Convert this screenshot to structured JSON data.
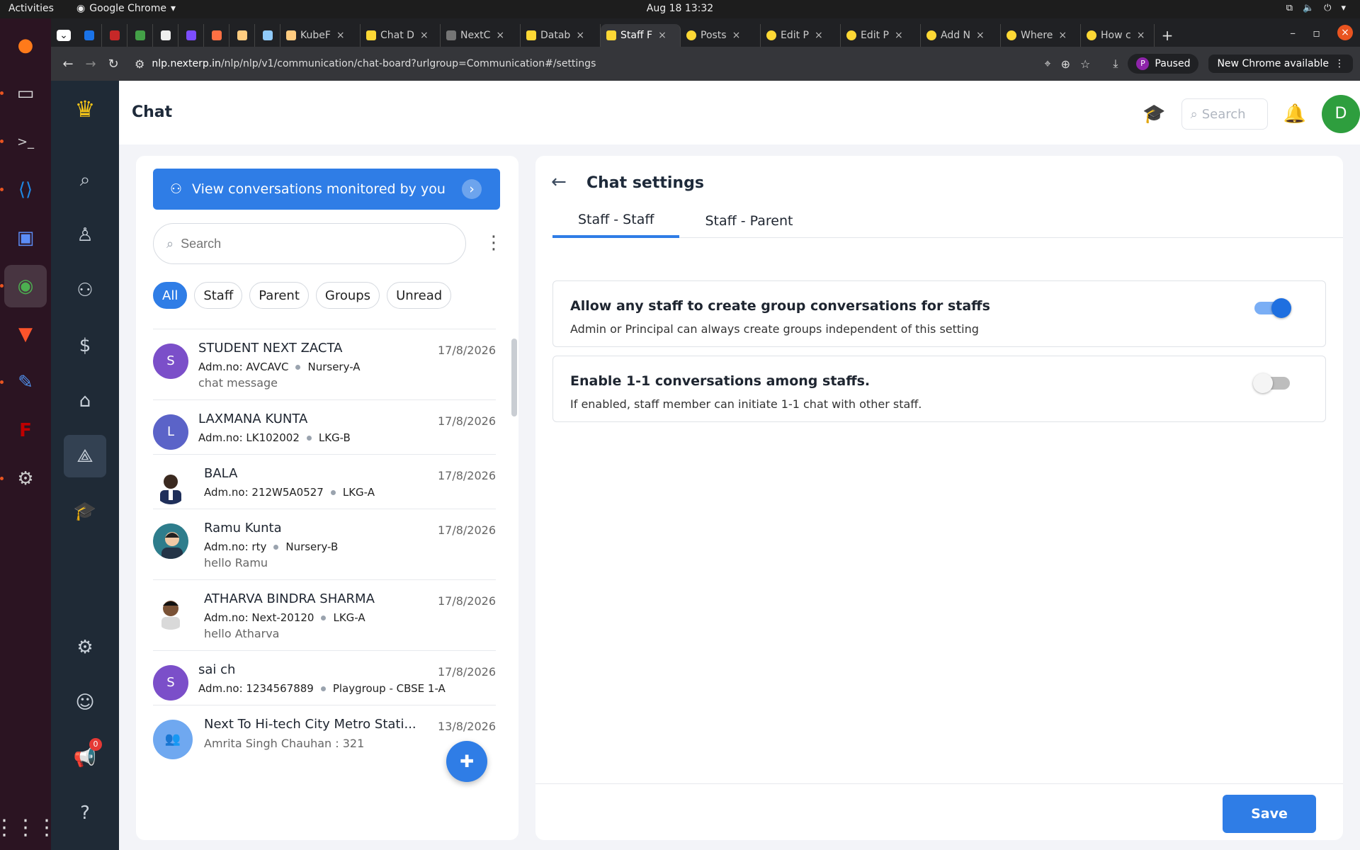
{
  "system": {
    "activities": "Activities",
    "app_name": "Google Chrome",
    "clock": "Aug 18  13:32"
  },
  "tabs": [
    {
      "label": ""
    },
    {
      "label": ""
    },
    {
      "label": ""
    },
    {
      "label": ""
    },
    {
      "label": ""
    },
    {
      "label": ""
    },
    {
      "label": ""
    },
    {
      "label": "KubeF"
    },
    {
      "label": "Chat D"
    },
    {
      "label": "NextC"
    },
    {
      "label": "Datab"
    },
    {
      "label": "Staff F"
    },
    {
      "label": "Posts"
    },
    {
      "label": "Edit P"
    },
    {
      "label": "Edit P"
    },
    {
      "label": "Add N"
    },
    {
      "label": "Where"
    },
    {
      "label": "How c"
    }
  ],
  "browser": {
    "url_host": "nlp.nexterp.in",
    "url_path": "/nlp/nlp/v1/communication/chat-board?urlgroup=Communication#/settings",
    "paused_label": "Paused",
    "profile_initial": "P",
    "update_label": "New Chrome available"
  },
  "app": {
    "title": "Chat",
    "search_placeholder": "Search",
    "user_initial": "D",
    "notification_count": "0"
  },
  "left": {
    "monitor_label": "View conversations monitored by you",
    "search_placeholder": "Search",
    "filters": [
      "All",
      "Staff",
      "Parent",
      "Groups",
      "Unread"
    ],
    "conversations": [
      {
        "initial": "S",
        "name": "STUDENT NEXT ZACTA",
        "adm": "Adm.no: AVCAVC",
        "class": "Nursery-A",
        "msg": "chat message",
        "date": "17/8/2026"
      },
      {
        "initial": "L",
        "name": "LAXMANA KUNTA",
        "adm": "Adm.no: LK102002",
        "class": "LKG-B",
        "msg": "",
        "date": "17/8/2026"
      },
      {
        "initial": "",
        "name": "BALA",
        "adm": "Adm.no: 212W5A0527",
        "class": "LKG-A",
        "msg": "",
        "date": "17/8/2026"
      },
      {
        "initial": "",
        "name": "Ramu Kunta",
        "adm": "Adm.no: rty",
        "class": "Nursery-B",
        "msg": "hello Ramu",
        "date": "17/8/2026"
      },
      {
        "initial": "",
        "name": "ATHARVA BINDRA SHARMA",
        "adm": "Adm.no: Next-20120",
        "class": "LKG-A",
        "msg": "hello Atharva",
        "date": "17/8/2026"
      },
      {
        "initial": "S",
        "name": "sai ch",
        "adm": "Adm.no: 1234567889",
        "class": "Playgroup - CBSE 1-A",
        "msg": "",
        "date": "17/8/2026"
      },
      {
        "initial": "",
        "name": "Next To Hi-tech City Metro Stati...",
        "adm": "",
        "class": "",
        "msg": "Amrita Singh Chauhan : 321",
        "date": "13/8/2026"
      }
    ]
  },
  "settings": {
    "title": "Chat settings",
    "tabs": [
      "Staff - Staff",
      "Staff - Parent"
    ],
    "items": [
      {
        "title": "Allow any staff to create group conversations for staffs",
        "desc": "Admin or Principal can always create groups independent of this setting",
        "enabled": true
      },
      {
        "title": "Enable 1-1 conversations among staffs.",
        "desc": "If enabled, staff member can initiate 1-1 chat with other staff.",
        "enabled": false
      }
    ],
    "save_label": "Save"
  },
  "colors": {
    "accent": "#2f7de6",
    "avatar_purple": "#7b4fc9",
    "avatar_indigo": "#5b63c8",
    "toggle_on": "#1e6fe0",
    "toggle_off": "#bdbdbd"
  }
}
